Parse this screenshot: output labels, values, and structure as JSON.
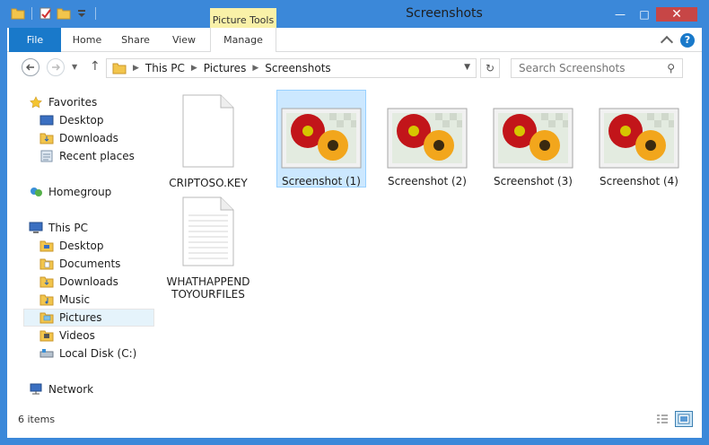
{
  "window": {
    "title": "Screenshots",
    "contextual_tab_group": "Picture Tools",
    "minimize": "—",
    "maximize": "□",
    "close": "✕"
  },
  "ribbon": {
    "tabs": [
      {
        "label": "File"
      },
      {
        "label": "Home"
      },
      {
        "label": "Share"
      },
      {
        "label": "View"
      },
      {
        "label": "Manage"
      }
    ],
    "help": "?"
  },
  "address": {
    "crumbs": [
      "This PC",
      "Pictures",
      "Screenshots"
    ],
    "search_placeholder": "Search Screenshots"
  },
  "sidebar": {
    "favorites": "Favorites",
    "favorites_items": [
      "Desktop",
      "Downloads",
      "Recent places"
    ],
    "homegroup": "Homegroup",
    "thispc": "This PC",
    "thispc_items": [
      "Desktop",
      "Documents",
      "Downloads",
      "Music",
      "Pictures",
      "Videos",
      "Local Disk (C:)"
    ],
    "network": "Network"
  },
  "files": [
    {
      "name": "CRIPTOSO.KEY",
      "type": "blank"
    },
    {
      "name": "Screenshot (1)",
      "type": "image"
    },
    {
      "name": "Screenshot (2)",
      "type": "image"
    },
    {
      "name": "Screenshot (3)",
      "type": "image"
    },
    {
      "name": "Screenshot (4)",
      "type": "image"
    },
    {
      "name_line1": "WHATHAPPEND",
      "name_line2": "TOYOURFILES",
      "type": "text"
    }
  ],
  "status": {
    "item_count": "6 items"
  },
  "colors": {
    "frame": "#3b88d9",
    "file_tab": "#1979ca",
    "selection": "#cce8ff",
    "picture_tools": "#f9f1a8"
  }
}
